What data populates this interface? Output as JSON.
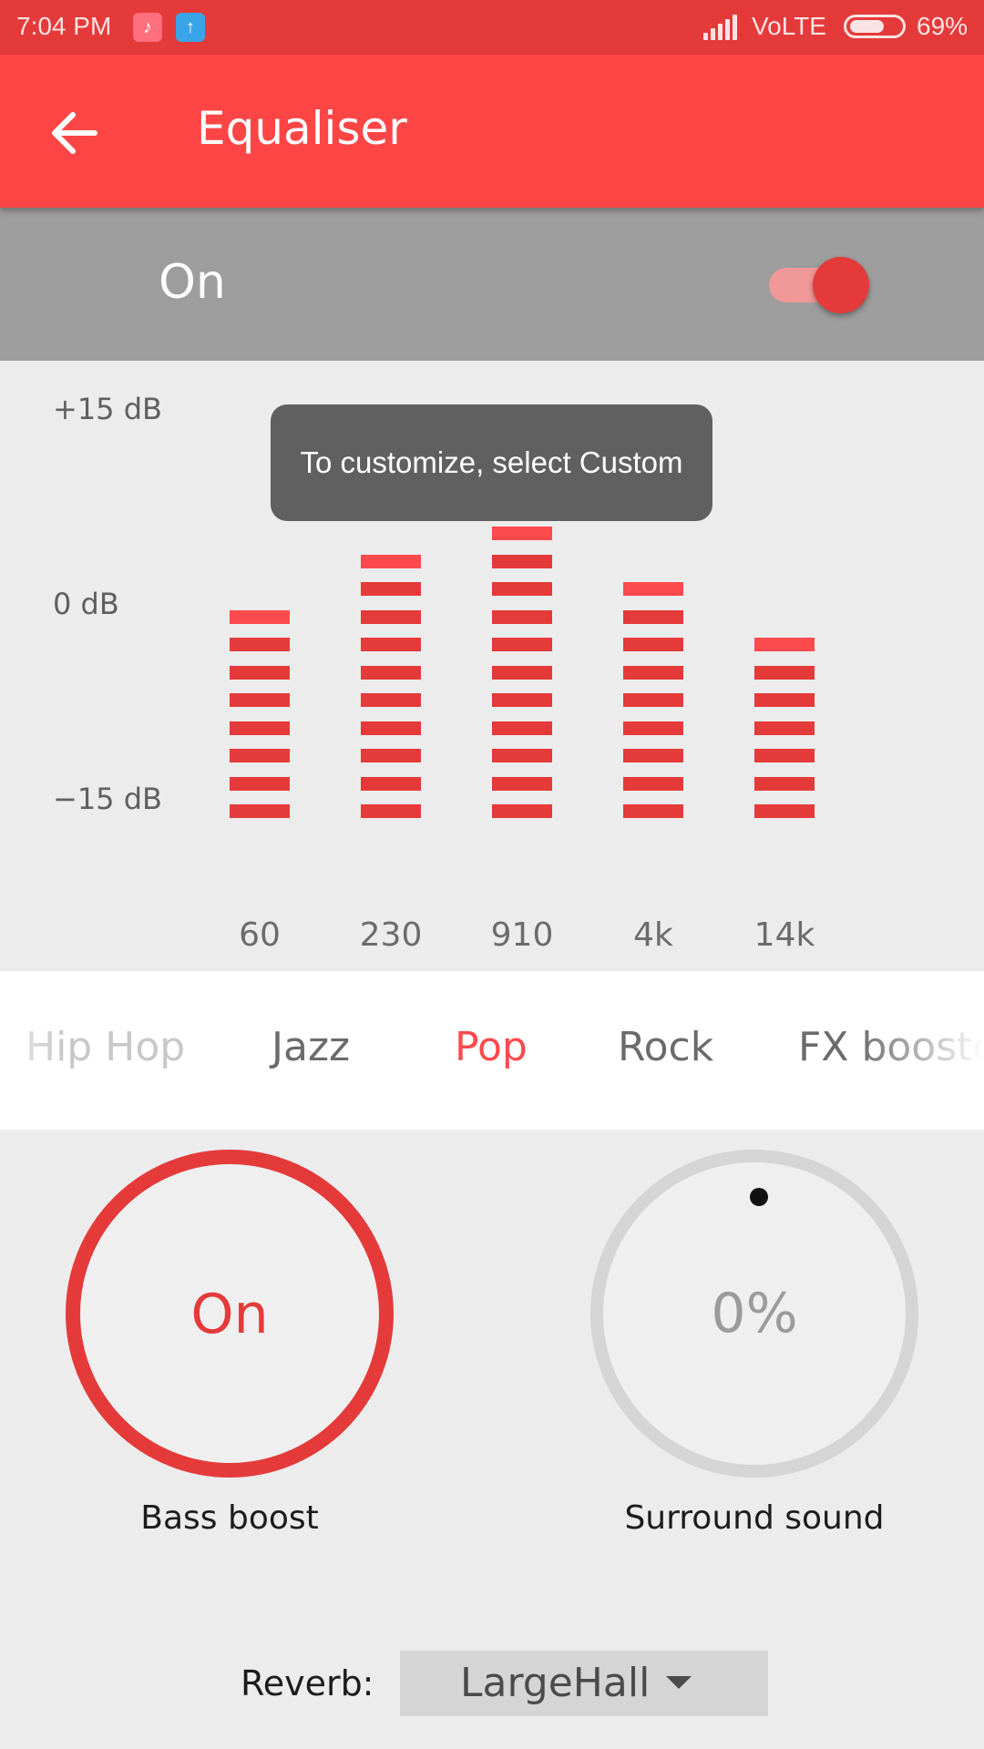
{
  "status_bar": {
    "time": "7:04 PM",
    "network": "VoLTE",
    "battery": "69%",
    "battery_level": 0.69,
    "icons": [
      "tiktok-notification-icon",
      "upload-notification-icon",
      "signal-icon",
      "battery-icon"
    ]
  },
  "app_bar": {
    "title": "Equaliser",
    "back_icon": "arrow-left-icon"
  },
  "master": {
    "label": "On",
    "enabled": true
  },
  "eq": {
    "db_labels": {
      "top": "+15 dB",
      "mid": "0 dB",
      "bottom": "−15 dB"
    },
    "bands": [
      {
        "freq": "60",
        "segments": 8
      },
      {
        "freq": "230",
        "segments": 10
      },
      {
        "freq": "910",
        "segments": 11
      },
      {
        "freq": "4k",
        "segments": 9
      },
      {
        "freq": "14k",
        "segments": 7
      }
    ],
    "toast": "To customize, select Custom"
  },
  "presets": {
    "items": [
      "Hip Hop",
      "Jazz",
      "Pop",
      "Rock",
      "FX booste"
    ],
    "selected": "Pop"
  },
  "effects": {
    "bass_boost": {
      "value": "On",
      "label": "Bass boost"
    },
    "surround": {
      "value": "0%",
      "label": "Surround sound"
    },
    "reverb": {
      "label": "Reverb:",
      "value": "LargeHall"
    }
  },
  "colors": {
    "status_bar": "#e53a3a",
    "app_bar": "#fe4546",
    "accent": "#e53a3a",
    "master_row": "#9d9d9d",
    "toast": "#606060"
  }
}
